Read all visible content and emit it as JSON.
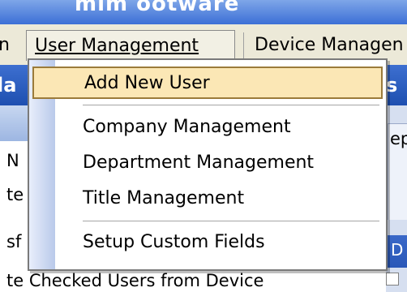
{
  "window": {
    "title_fragment": "mim ootware"
  },
  "menubar": {
    "items": [
      {
        "label": "n"
      },
      {
        "label": "User Management"
      },
      {
        "label": "Device Managen"
      }
    ]
  },
  "left_panel": {
    "header": "la",
    "rows": [
      "N",
      "te",
      "sf"
    ]
  },
  "right_panel": {
    "header": "s",
    "box_text": "ep",
    "blue_text": "D"
  },
  "dropdown": {
    "items": [
      {
        "label": "Add New User",
        "highlighted": true
      },
      {
        "label": "Company Management"
      },
      {
        "label": "Department Management"
      },
      {
        "label": "Title Management"
      },
      {
        "label": "Setup Custom Fields"
      }
    ]
  },
  "bottom": {
    "text": "te Checked Users from Device"
  },
  "colors": {
    "titlebar": "#3c6fd6",
    "menubar": "#ece9d8",
    "highlight": "#fbe7b5",
    "highlight_border": "#9b7b3a",
    "header_blue": "#1e4fb0"
  }
}
